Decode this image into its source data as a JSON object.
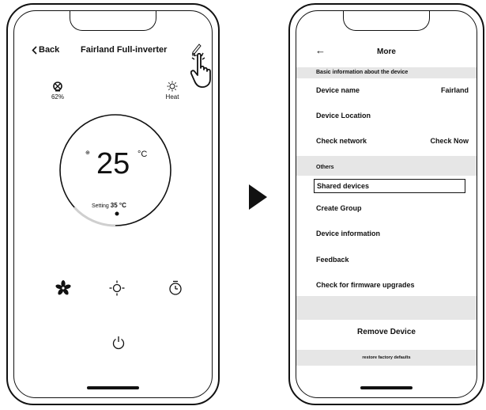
{
  "left_screen": {
    "header": {
      "back_label": "Back",
      "device_title": "Fairland Full-inverter"
    },
    "humidity": {
      "value": "62%"
    },
    "mode": {
      "label": "Heat"
    },
    "temperature": {
      "value": "25",
      "unit": "°C",
      "setting_label": "Setting",
      "setting_value": "35 °C"
    },
    "controls": [
      "fan-icon",
      "brightness-icon",
      "timer-icon",
      "power-icon"
    ]
  },
  "right_screen": {
    "header": {
      "title": "More"
    },
    "section_basic": "Basic information about the device",
    "rows_basic": [
      {
        "label": "Device name",
        "value": "Fairland"
      },
      {
        "label": "Device Location",
        "value": ""
      },
      {
        "label": "Check network",
        "value": "Check Now"
      }
    ],
    "section_others": "Others",
    "rows_others": [
      {
        "label": "Shared devices"
      },
      {
        "label": "Create Group"
      },
      {
        "label": "Device information"
      },
      {
        "label": "Feedback"
      },
      {
        "label": "Check for firmware upgrades"
      }
    ],
    "remove_label": "Remove Device",
    "restore_label": "restore factory defaults"
  }
}
